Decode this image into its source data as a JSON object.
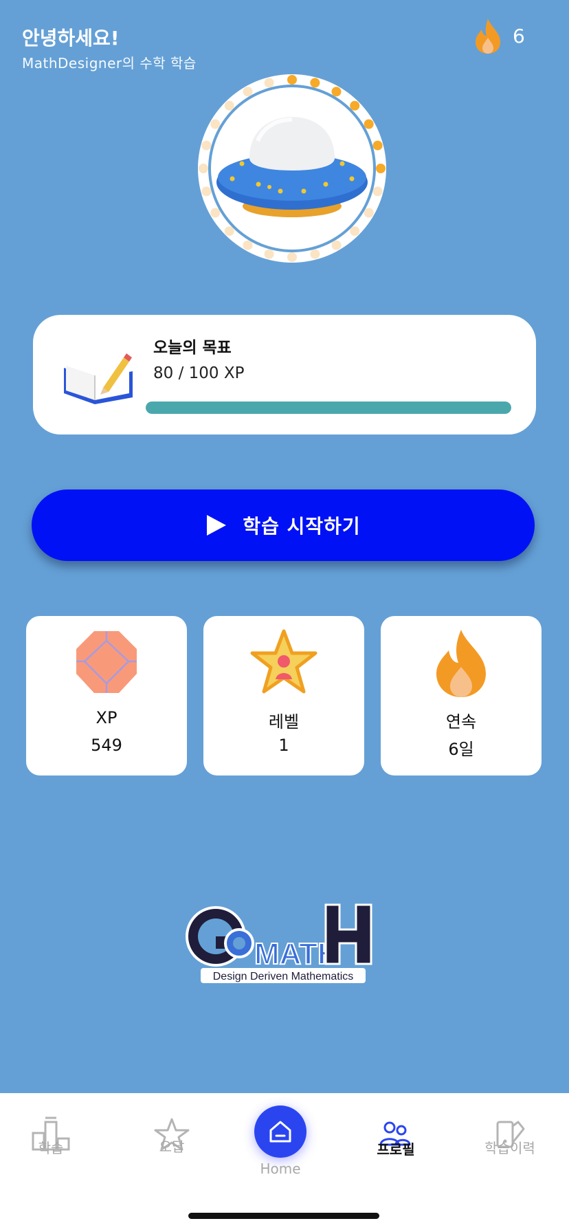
{
  "header": {
    "greeting": "안녕하세요!",
    "subtitle": "MathDesigner의 수학 학습",
    "streak_count": "6",
    "streak_icon": "fire-icon"
  },
  "avatar": {
    "icon": "ufo-icon"
  },
  "goal": {
    "title": "오늘의 목표",
    "xp_text": "80 / 100 XP",
    "progress": 1.0,
    "icon": "book-pencil-icon",
    "bar_color": "#4aa8ad"
  },
  "start_button": {
    "label": "학습 시작하기",
    "icon": "play-icon",
    "color": "#0011f5"
  },
  "stats": [
    {
      "label": "XP",
      "value": "549",
      "icon": "gem-icon"
    },
    {
      "label": "레벨",
      "value": "1",
      "icon": "star-icon"
    },
    {
      "label": "연속",
      "value": "6일",
      "icon": "fire-icon"
    }
  ],
  "logo": {
    "wordmark": "MATH",
    "tagline": "Design Deriven Mathematics"
  },
  "nav": {
    "items": [
      {
        "label": "학습",
        "icon": "chart-icon"
      },
      {
        "label": "오답",
        "icon": "star-outline-icon"
      },
      {
        "label": "Home",
        "icon": "home-icon"
      },
      {
        "label": "프로필",
        "icon": "users-icon"
      },
      {
        "label": "학습이력",
        "icon": "history-icon"
      }
    ],
    "active_color": "#2a45f0"
  }
}
